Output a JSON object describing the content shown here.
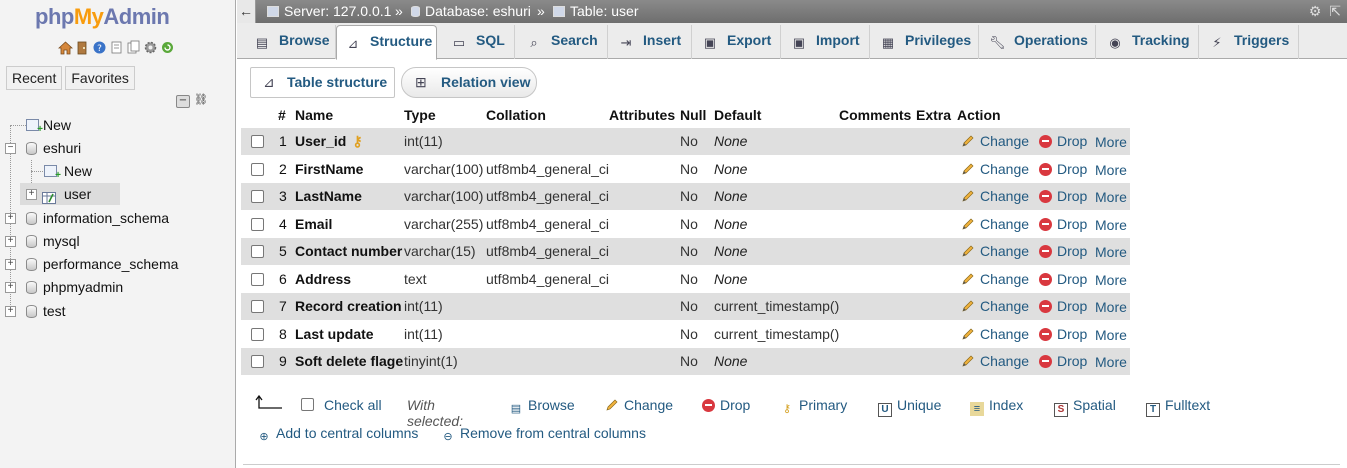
{
  "nav": {
    "logo": {
      "php": "php",
      "my": "My",
      "admin": "Admin"
    },
    "tabs": [
      "Recent",
      "Favorites"
    ],
    "tree": [
      {
        "label": "New",
        "kind": "new",
        "level": 0
      },
      {
        "label": "eshuri",
        "kind": "db",
        "level": 0,
        "expanded": true
      },
      {
        "label": "New",
        "kind": "new",
        "level": 1
      },
      {
        "label": "user",
        "kind": "table",
        "level": 1,
        "active": true
      },
      {
        "label": "information_schema",
        "kind": "db",
        "level": 0
      },
      {
        "label": "mysql",
        "kind": "db",
        "level": 0
      },
      {
        "label": "performance_schema",
        "kind": "db",
        "level": 0
      },
      {
        "label": "phpmyadmin",
        "kind": "db",
        "level": 0
      },
      {
        "label": "test",
        "kind": "db",
        "level": 0
      }
    ]
  },
  "breadcrumb": {
    "server": "Server: 127.0.0.1",
    "database": "Database: eshuri",
    "table": "Table: user",
    "separator": "»"
  },
  "tabs": [
    "Browse",
    "Structure",
    "SQL",
    "Search",
    "Insert",
    "Export",
    "Import",
    "Privileges",
    "Operations",
    "Tracking",
    "Triggers"
  ],
  "active_tab": "Structure",
  "subtabs": [
    "Table structure",
    "Relation view"
  ],
  "table": {
    "headers": [
      "#",
      "Name",
      "Type",
      "Collation",
      "Attributes",
      "Null",
      "Default",
      "Comments",
      "Extra",
      "Action"
    ],
    "rows": [
      {
        "num": "1",
        "name": "User_id",
        "type": "int(11)",
        "collation": "",
        "null": "No",
        "default": "None",
        "primary": true
      },
      {
        "num": "2",
        "name": "FirstName",
        "type": "varchar(100)",
        "collation": "utf8mb4_general_ci",
        "null": "No",
        "default": "None"
      },
      {
        "num": "3",
        "name": "LastName",
        "type": "varchar(100)",
        "collation": "utf8mb4_general_ci",
        "null": "No",
        "default": "None"
      },
      {
        "num": "4",
        "name": "Email",
        "type": "varchar(255)",
        "collation": "utf8mb4_general_ci",
        "null": "No",
        "default": "None"
      },
      {
        "num": "5",
        "name": "Contact number",
        "type": "varchar(15)",
        "collation": "utf8mb4_general_ci",
        "null": "No",
        "default": "None"
      },
      {
        "num": "6",
        "name": "Address",
        "type": "text",
        "collation": "utf8mb4_general_ci",
        "null": "No",
        "default": "None"
      },
      {
        "num": "7",
        "name": "Record creation",
        "type": "int(11)",
        "collation": "",
        "null": "No",
        "default": "current_timestamp()"
      },
      {
        "num": "8",
        "name": "Last update",
        "type": "int(11)",
        "collation": "",
        "null": "No",
        "default": "current_timestamp()"
      },
      {
        "num": "9",
        "name": "Soft delete flage",
        "type": "tinyint(1)",
        "collation": "",
        "null": "No",
        "default": "None"
      }
    ],
    "actions": {
      "change": "Change",
      "drop": "Drop",
      "more": "More"
    }
  },
  "bottom": {
    "check_all": "Check all",
    "with_selected": "With selected:",
    "actions": [
      "Browse",
      "Change",
      "Drop",
      "Primary",
      "Unique",
      "Index",
      "Spatial",
      "Fulltext"
    ],
    "central": [
      "Add to central columns",
      "Remove from central columns"
    ]
  },
  "colors": {
    "link": "#235a81",
    "logo_blue": "#6c78af",
    "logo_orange": "#f89c0e",
    "row_alt": "#dfdfdf",
    "breadcrumb_bg": "#7a7a7a",
    "drop_red": "#d9383f"
  }
}
